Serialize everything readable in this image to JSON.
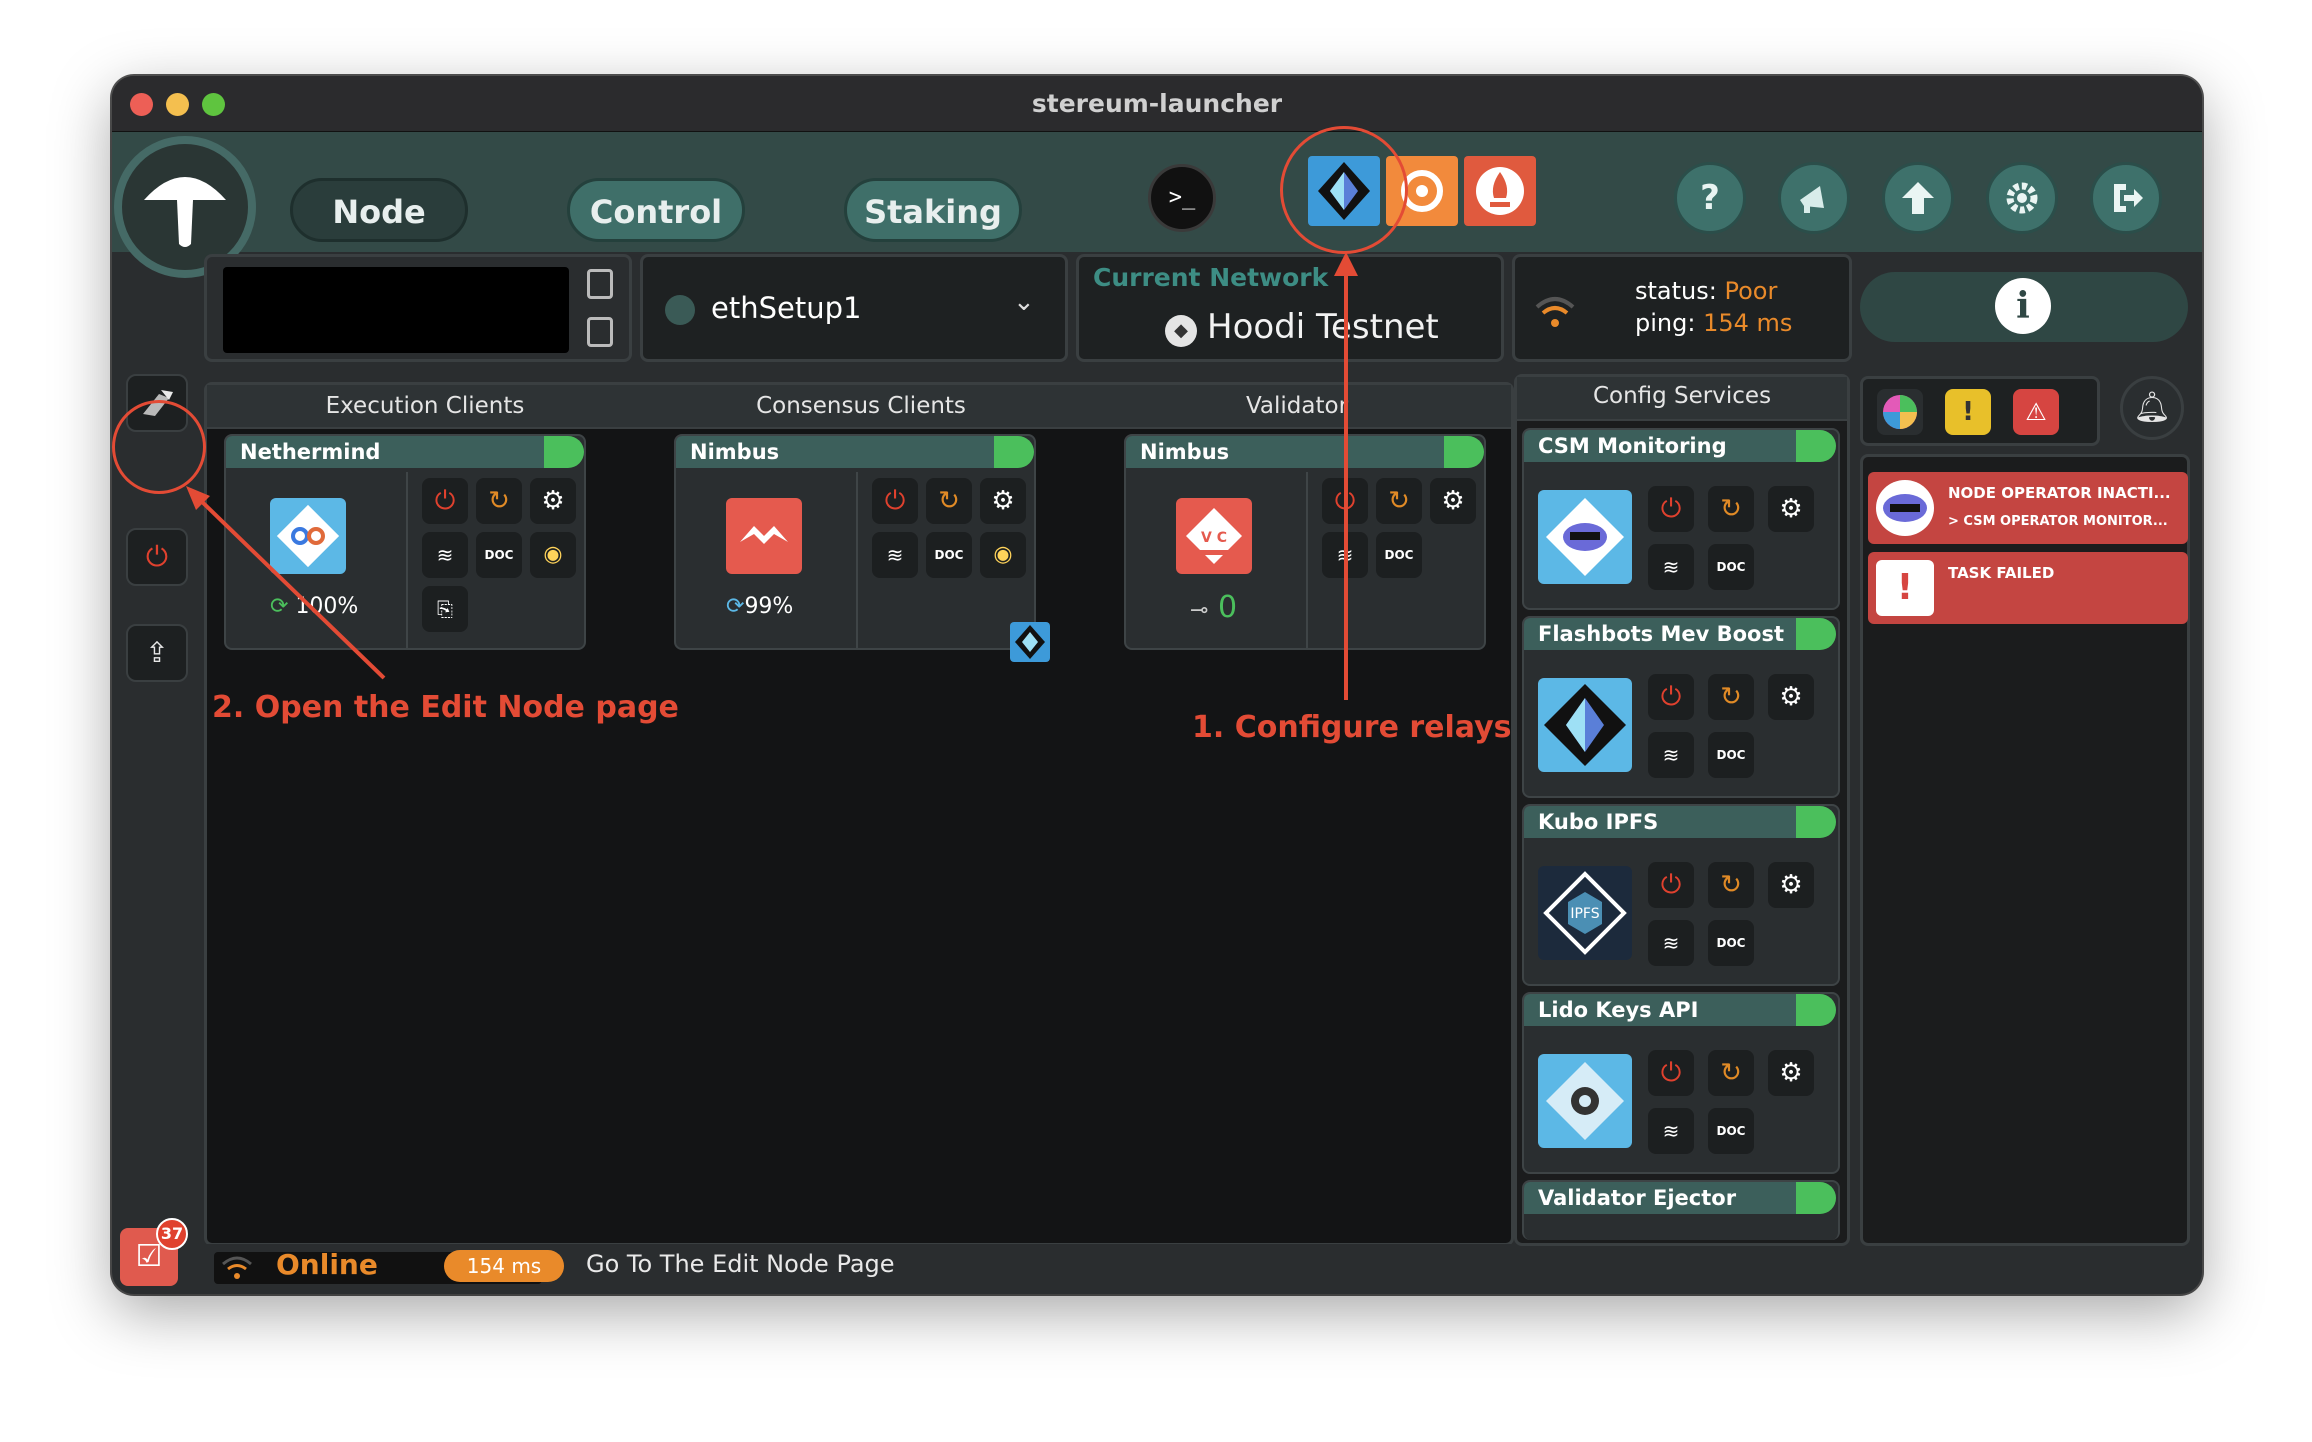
{
  "window": {
    "title": "stereum-launcher"
  },
  "nav": {
    "node": "Node",
    "control": "Control",
    "staking": "Staking"
  },
  "header_icons": {
    "terminal": "terminal-icon",
    "help": "?",
    "help_icon": "question-icon",
    "announce_icon": "megaphone-icon",
    "update_icon": "arrow-up-icon",
    "settings_icon": "gear-icon",
    "logout_icon": "logout-icon"
  },
  "setup": {
    "name": "ethSetup1"
  },
  "network": {
    "label": "Current Network",
    "name": "Hoodi Testnet"
  },
  "connection": {
    "status_label": "status:",
    "status_value": "Poor",
    "ping_label": "ping:",
    "ping_value": "154 ms"
  },
  "columns": {
    "execution": "Execution Clients",
    "consensus": "Consensus Clients",
    "validator": "Validator",
    "config": "Config Services"
  },
  "clients": {
    "execution": {
      "name": "Nethermind",
      "sync": "100%"
    },
    "consensus": {
      "name": "Nimbus",
      "sync": "99%"
    },
    "validator": {
      "name": "Nimbus",
      "keys": "0"
    }
  },
  "services": [
    {
      "name": "CSM Monitoring"
    },
    {
      "name": "Flashbots Mev Boost"
    },
    {
      "name": "Kubo IPFS"
    },
    {
      "name": "Lido Keys API"
    },
    {
      "name": "Validator Ejector"
    }
  ],
  "notifications": [
    {
      "title": "NODE OPERATOR INACTI...",
      "sub": "> CSM OPERATOR MONITOR..."
    },
    {
      "title": "TASK FAILED"
    }
  ],
  "footer": {
    "status": "Online",
    "ping": "154 ms",
    "hint": "Go To The Edit Node Page",
    "tasks_badge": "37"
  },
  "annotations": {
    "a1": "1. Configure relays",
    "a2": "2.  Open the Edit Node page"
  },
  "colors": {
    "accent": "#3f6f69",
    "online": "#e98a2a",
    "annotation": "#e34b35",
    "toggle": "#4bbf5c"
  }
}
